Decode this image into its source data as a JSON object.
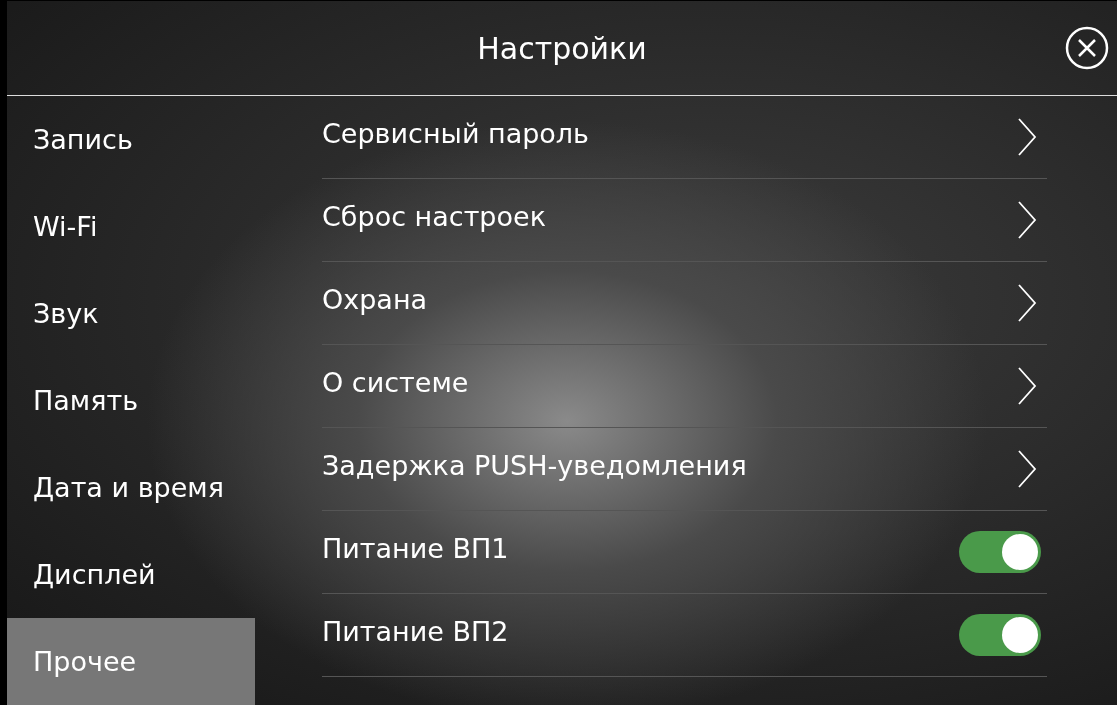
{
  "header": {
    "title": "Настройки"
  },
  "sidebar": {
    "items": [
      {
        "label": "Запись",
        "selected": false
      },
      {
        "label": "Wi-Fi",
        "selected": false
      },
      {
        "label": "Звук",
        "selected": false
      },
      {
        "label": "Память",
        "selected": false
      },
      {
        "label": "Дата и время",
        "selected": false
      },
      {
        "label": "Дисплей",
        "selected": false
      },
      {
        "label": "Прочее",
        "selected": true
      }
    ]
  },
  "settings": [
    {
      "kind": "link",
      "label": "Сервисный пароль"
    },
    {
      "kind": "link",
      "label": "Сброс настроек"
    },
    {
      "kind": "link",
      "label": "Охрана"
    },
    {
      "kind": "link",
      "label": "О системе"
    },
    {
      "kind": "link",
      "label": "Задержка PUSH-уведомления"
    },
    {
      "kind": "toggle",
      "label": "Питание ВП1",
      "on": true
    },
    {
      "kind": "toggle",
      "label": "Питание ВП2",
      "on": true
    }
  ]
}
